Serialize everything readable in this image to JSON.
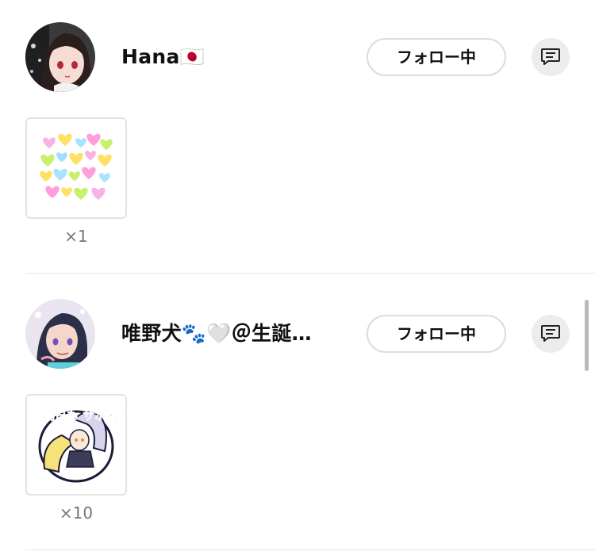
{
  "entries": [
    {
      "user_name": "Hana🇯🇵",
      "follow_label": "フォロー中",
      "gift_count": "×1",
      "avatar_icon": "user-avatar-anime-girl",
      "gift_icon": "colorful-hearts-sticker"
    },
    {
      "user_name": "唯野犬🐾🤍＠生誕…",
      "follow_label": "フォロー中",
      "gift_count": "×10",
      "avatar_icon": "user-avatar-anime-boy",
      "gift_icon": "asu-mo-saboro-sticker",
      "gift_sticker_text": "明日も サボろ〜"
    }
  ],
  "message_icon": "chat-bubble-icon",
  "colors": {
    "text": "#111111",
    "secondary_text": "#777777",
    "button_border": "#dcdcdc",
    "message_button_bg": "#ececec",
    "divider": "#e6e6e6"
  }
}
